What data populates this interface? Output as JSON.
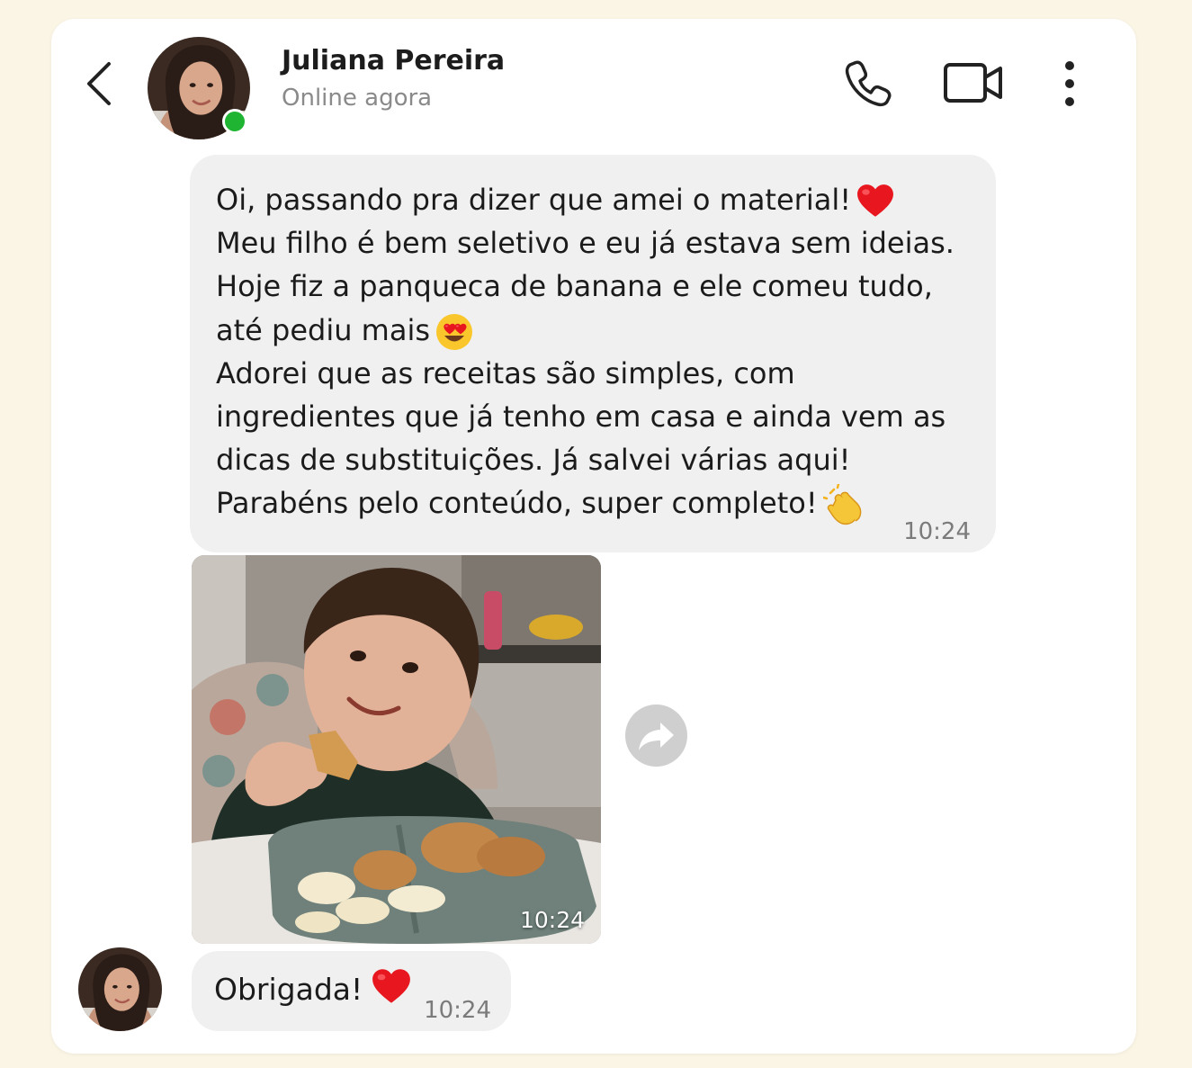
{
  "header": {
    "contact_name": "Juliana Pereira",
    "status": "Online agora"
  },
  "messages": [
    {
      "lines": [
        "Oi, passando pra dizer que amei o material!",
        "Meu filho é bem seletivo e eu já estava sem ideias.",
        "Hoje fiz a panqueca de banana e ele comeu tudo,",
        "até pediu mais",
        "Adorei que as receitas são simples, com",
        "ingredientes que já tenho em casa e ainda vem as",
        "dicas de substituições. Já salvei várias aqui!",
        "Parabéns pelo conteúdo, super completo!"
      ],
      "time": "10:24"
    },
    {
      "type": "photo",
      "time": "10:24"
    },
    {
      "text": "Obrigada!",
      "time": "10:24"
    }
  ],
  "icons": {
    "back": "chevron-left-icon",
    "call": "phone-icon",
    "video": "video-camera-icon",
    "more": "more-vertical-icon",
    "share": "share-arrow-icon",
    "heart": "red-heart-emoji",
    "heart_eyes": "heart-eyes-emoji",
    "clap": "clapping-hands-emoji"
  },
  "colors": {
    "background": "#fbf5e6",
    "card": "#ffffff",
    "bubble": "#f0f0f0",
    "online": "#1fb533",
    "heart": "#e8161e"
  }
}
